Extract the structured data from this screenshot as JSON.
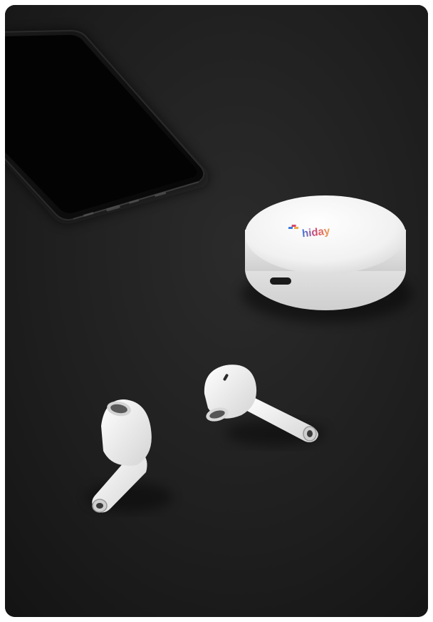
{
  "photo": {
    "brand_logo_text": "hiday"
  },
  "colors": {
    "surface": "#1e1e1e",
    "device_white": "#f4f4f4",
    "phone_body": "#111111"
  },
  "icons": {
    "brand_mark": "hiday-logo-icon"
  }
}
